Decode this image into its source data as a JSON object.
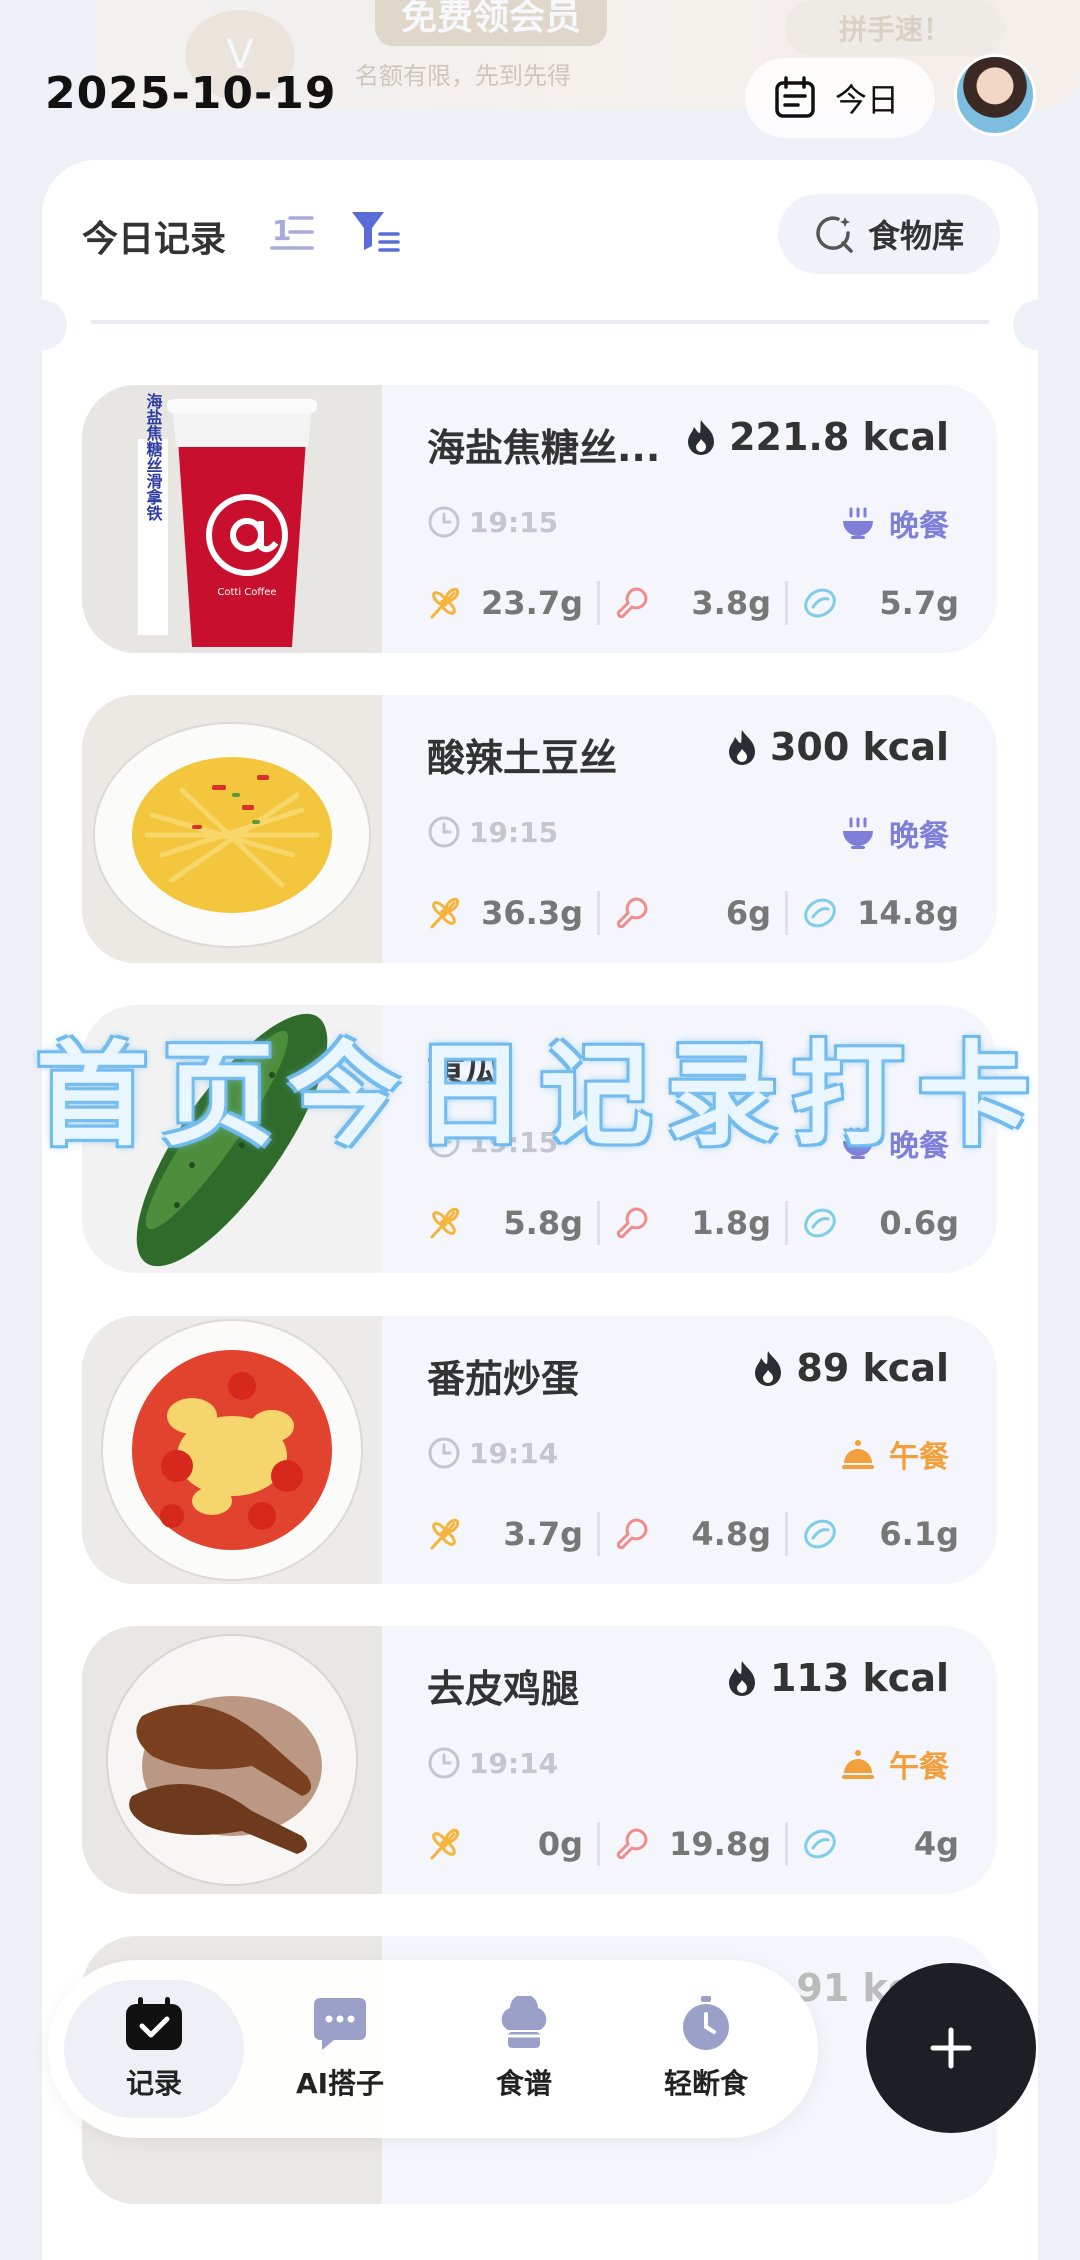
{
  "promo": {
    "badge": "V",
    "title": "免费领会员",
    "subtitle": "名额有限，先到先得",
    "button": "拼手速！"
  },
  "header": {
    "date": "2025-10-19",
    "today_label": "今日"
  },
  "records": {
    "title": "今日记录",
    "food_library_label": "食物库",
    "items": [
      {
        "name": "海盐焦糖丝...",
        "kcal": "221.8 kcal",
        "time": "19:15",
        "meal": "晚餐",
        "carbs": "23.7g",
        "protein": "3.8g",
        "fat": "5.7g",
        "cup_text": "海盐焦糖丝滑拿铁",
        "cup_brand": "Cotti Coffee"
      },
      {
        "name": "酸辣土豆丝",
        "kcal": "300 kcal",
        "time": "19:15",
        "meal": "晚餐",
        "carbs": "36.3g",
        "protein": "6g",
        "fat": "14.8g"
      },
      {
        "name": "黄瓜",
        "kcal": "",
        "time": "19:15",
        "meal": "晚餐",
        "carbs": "5.8g",
        "protein": "1.8g",
        "fat": "0.6g"
      },
      {
        "name": "番茄炒蛋",
        "kcal": "89 kcal",
        "time": "19:14",
        "meal": "午餐",
        "carbs": "3.7g",
        "protein": "4.8g",
        "fat": "6.1g"
      },
      {
        "name": "去皮鸡腿",
        "kcal": "113 kcal",
        "time": "19:14",
        "meal": "午餐",
        "carbs": "0g",
        "protein": "19.8g",
        "fat": "4g"
      },
      {
        "name": "",
        "kcal": "91 kcal",
        "time": "",
        "meal": "",
        "carbs": "",
        "protein": "",
        "fat": ""
      }
    ]
  },
  "overlay": {
    "caption": "首页今日记录打卡"
  },
  "nav": {
    "record": "记录",
    "ai": "AI搭子",
    "recipe": "食谱",
    "fasting": "轻断食"
  },
  "colors": {
    "dinner": "#7f7fd9",
    "lunch": "#f2a03c",
    "carbs": "#f5b43c",
    "protein": "#ef8c8c",
    "fat": "#7fcde8"
  }
}
